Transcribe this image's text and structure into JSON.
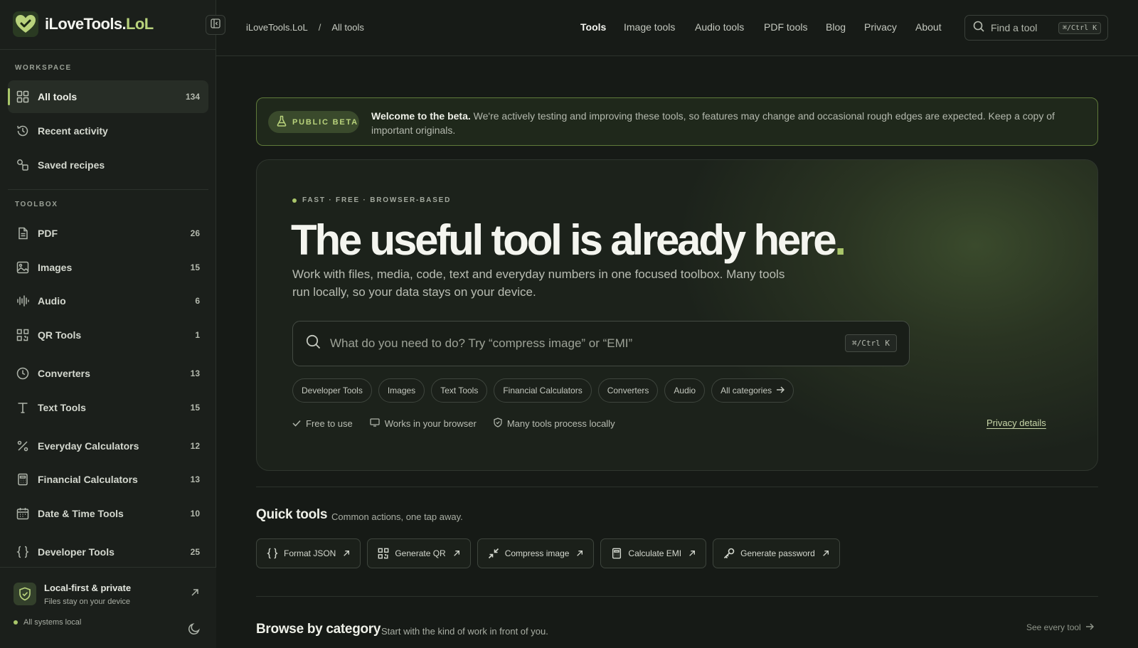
{
  "brand": {
    "name_main": "iLoveTools.",
    "name_accent": "LoL"
  },
  "sidebar": {
    "workspace_label": "WORKSPACE",
    "workspace_items": [
      {
        "label": "All tools",
        "count": "134",
        "icon": "grid-icon",
        "active": true
      },
      {
        "label": "Recent activity",
        "count": "",
        "icon": "history-icon"
      },
      {
        "label": "Saved recipes",
        "count": "",
        "icon": "recipes-icon"
      }
    ],
    "toolbox_label": "TOOLBOX",
    "toolbox_items": [
      {
        "label": "PDF",
        "count": "26",
        "icon": "document-icon"
      },
      {
        "label": "Images",
        "count": "15",
        "icon": "image-icon"
      },
      {
        "label": "Audio",
        "count": "6",
        "icon": "waveform-icon"
      },
      {
        "label": "QR Tools",
        "count": "1",
        "icon": "qr-icon"
      },
      {
        "label": "Converters",
        "count": "13",
        "icon": "clock-icon"
      },
      {
        "label": "Text Tools",
        "count": "15",
        "icon": "text-icon"
      },
      {
        "label": "Everyday Calculators",
        "count": "12",
        "icon": "percent-icon"
      },
      {
        "label": "Financial Calculators",
        "count": "13",
        "icon": "calculator-icon"
      },
      {
        "label": "Date & Time Tools",
        "count": "10",
        "icon": "calendar-icon"
      },
      {
        "label": "Developer Tools",
        "count": "25",
        "icon": "braces-icon"
      }
    ],
    "footer": {
      "title": "Local-first & private",
      "subtitle": "Files stay on your device",
      "status": "All systems local"
    }
  },
  "topbar": {
    "breadcrumb": [
      "iLoveTools.LoL",
      "All tools"
    ],
    "nav": [
      {
        "label": "Tools",
        "active": true
      },
      {
        "label": "Image tools"
      },
      {
        "label": "Audio tools"
      },
      {
        "label": "PDF tools"
      },
      {
        "label": "Blog"
      },
      {
        "label": "Privacy"
      },
      {
        "label": "About"
      }
    ],
    "search_placeholder": "Find a tool",
    "search_shortcut": "⌘/Ctrl K"
  },
  "beta": {
    "pill": "PUBLIC BETA",
    "title": "Welcome to the beta.",
    "text": "We're actively testing and improving these tools, so features may change and occasional rough edges are expected. Keep a copy of important originals."
  },
  "hero": {
    "eyebrow": "FAST · FREE · BROWSER-BASED",
    "title": "The useful tool is already here",
    "title_dot": ".",
    "subtitle": "Work with files, media, code, text and everyday numbers in one focused toolbox. Many tools run locally, so your data stays on your device.",
    "search_placeholder": "What do you need to do? Try “compress image” or “EMI”",
    "search_shortcut": "⌘/Ctrl K",
    "chips": [
      "Developer Tools",
      "Images",
      "Text Tools",
      "Financial Calculators",
      "Converters",
      "Audio",
      "All categories"
    ],
    "assurances": [
      "Free to use",
      "Works in your browser",
      "Many tools process locally"
    ],
    "privacy_link": "Privacy details"
  },
  "quick_tools": {
    "title": "Quick tools",
    "subtitle": "Common actions, one tap away.",
    "items": [
      {
        "label": "Format JSON",
        "icon": "braces-icon"
      },
      {
        "label": "Generate QR",
        "icon": "qr-icon"
      },
      {
        "label": "Compress image",
        "icon": "compress-icon"
      },
      {
        "label": "Calculate EMI",
        "icon": "calculator-icon"
      },
      {
        "label": "Generate password",
        "icon": "key-icon"
      }
    ]
  },
  "browse": {
    "title": "Browse by category",
    "subtitle": "Start with the kind of work in front of you.",
    "see_all": "See every tool"
  },
  "colors": {
    "accent": "#a9c66a",
    "background": "#161a16",
    "sidebar": "#1b1f1b"
  }
}
